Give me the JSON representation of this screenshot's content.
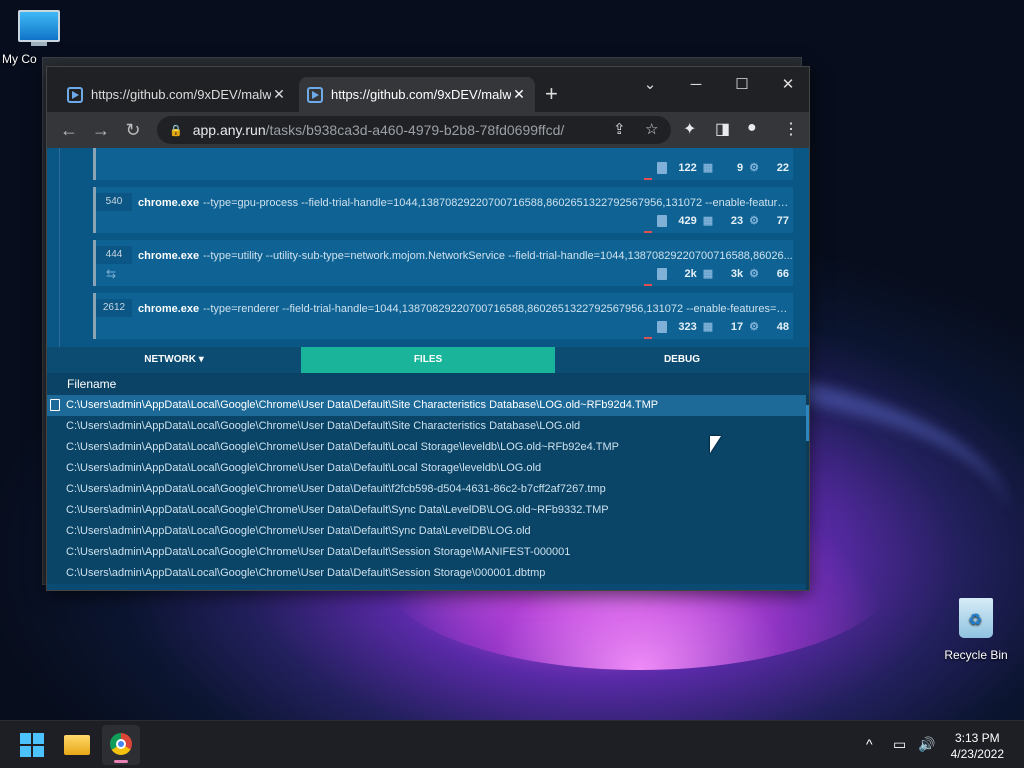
{
  "desktop": {
    "icons": [
      {
        "label": "My Co"
      },
      {
        "label": "Recycle Bin"
      }
    ]
  },
  "browser": {
    "tabs": [
      {
        "title": "https://github.com/9xDEV/malw"
      },
      {
        "title": "https://github.com/9xDEV/malw"
      }
    ],
    "address": {
      "host": "app.any.run",
      "path": "/tasks/b938ca3d-a460-4979-b2b8-78fd0699ffcd/"
    }
  },
  "processes": [
    {
      "pid": "",
      "name": "",
      "cmd": "",
      "files": "122",
      "modules": "9",
      "threads": "22"
    },
    {
      "pid": "540",
      "name": "chrome.exe",
      "cmd": "--type=gpu-process --field-trial-handle=1044,13870829220700716588,8602651322792567956,131072 --enable-features...",
      "files": "429",
      "modules": "23",
      "threads": "77"
    },
    {
      "pid": "444",
      "name": "chrome.exe",
      "cmd": "--type=utility --utility-sub-type=network.mojom.NetworkService --field-trial-handle=1044,13870829220700716588,86026...",
      "files": "2k",
      "modules": "3k",
      "threads": "66"
    },
    {
      "pid": "2612",
      "name": "chrome.exe",
      "cmd": "--type=renderer --field-trial-handle=1044,13870829220700716588,8602651322792567956,131072 --enable-features=Pa...",
      "files": "323",
      "modules": "17",
      "threads": "48"
    }
  ],
  "panel_tabs": {
    "network": "NETWORK ▾",
    "files": "FILES",
    "debug": "DEBUG"
  },
  "files_table": {
    "header": "Filename",
    "rows": [
      "C:\\Users\\admin\\AppData\\Local\\Google\\Chrome\\User Data\\Default\\Site Characteristics Database\\LOG.old~RFb92d4.TMP",
      "C:\\Users\\admin\\AppData\\Local\\Google\\Chrome\\User Data\\Default\\Site Characteristics Database\\LOG.old",
      "C:\\Users\\admin\\AppData\\Local\\Google\\Chrome\\User Data\\Default\\Local Storage\\leveldb\\LOG.old~RFb92e4.TMP",
      "C:\\Users\\admin\\AppData\\Local\\Google\\Chrome\\User Data\\Default\\Local Storage\\leveldb\\LOG.old",
      "C:\\Users\\admin\\AppData\\Local\\Google\\Chrome\\User Data\\Default\\f2fcb598-d504-4631-86c2-b7cff2af7267.tmp",
      "C:\\Users\\admin\\AppData\\Local\\Google\\Chrome\\User Data\\Default\\Sync Data\\LevelDB\\LOG.old~RFb9332.TMP",
      "C:\\Users\\admin\\AppData\\Local\\Google\\Chrome\\User Data\\Default\\Sync Data\\LevelDB\\LOG.old",
      "C:\\Users\\admin\\AppData\\Local\\Google\\Chrome\\User Data\\Default\\Session Storage\\MANIFEST-000001",
      "C:\\Users\\admin\\AppData\\Local\\Google\\Chrome\\User Data\\Default\\Session Storage\\000001.dbtmp"
    ]
  },
  "taskbar": {
    "time": "3:13 PM",
    "date": "4/23/2022"
  }
}
